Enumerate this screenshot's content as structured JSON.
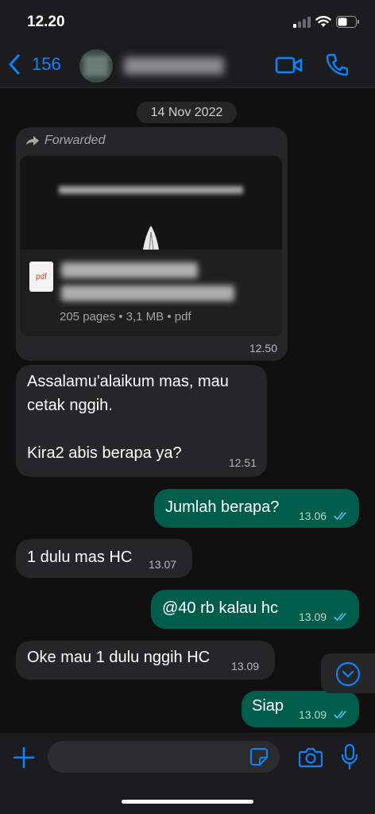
{
  "status_bar": {
    "time": "12.20"
  },
  "header": {
    "back_count": "156"
  },
  "chat": {
    "date": "14 Nov 2022",
    "forwarded_doc": {
      "forwarded_label": "Forwarded",
      "file_icon_label": "pdf",
      "meta": "205 pages • 3,1 MB • pdf",
      "time": "12.50"
    },
    "messages": [
      {
        "direction": "in",
        "text": "Assalamu'alaikum mas, mau\ncetak nggih.\n\nKira2 abis berapa ya?",
        "time": "12.51"
      },
      {
        "direction": "out",
        "text": "Jumlah berapa?",
        "time": "13.06"
      },
      {
        "direction": "in",
        "text": "1 dulu mas HC",
        "time": "13.07"
      },
      {
        "direction": "out",
        "text": "@40 rb kalau hc",
        "time": "13.09"
      },
      {
        "direction": "in",
        "text": "Oke mau 1 dulu nggih HC",
        "time": "13.09"
      },
      {
        "direction": "out",
        "text": "Siap",
        "time": "13.09"
      }
    ]
  },
  "colors": {
    "accent": "#0a84ff",
    "outgoing_bubble": "#005c4b",
    "incoming_bubble": "#262628",
    "read_ticks": "#53bdeb"
  }
}
